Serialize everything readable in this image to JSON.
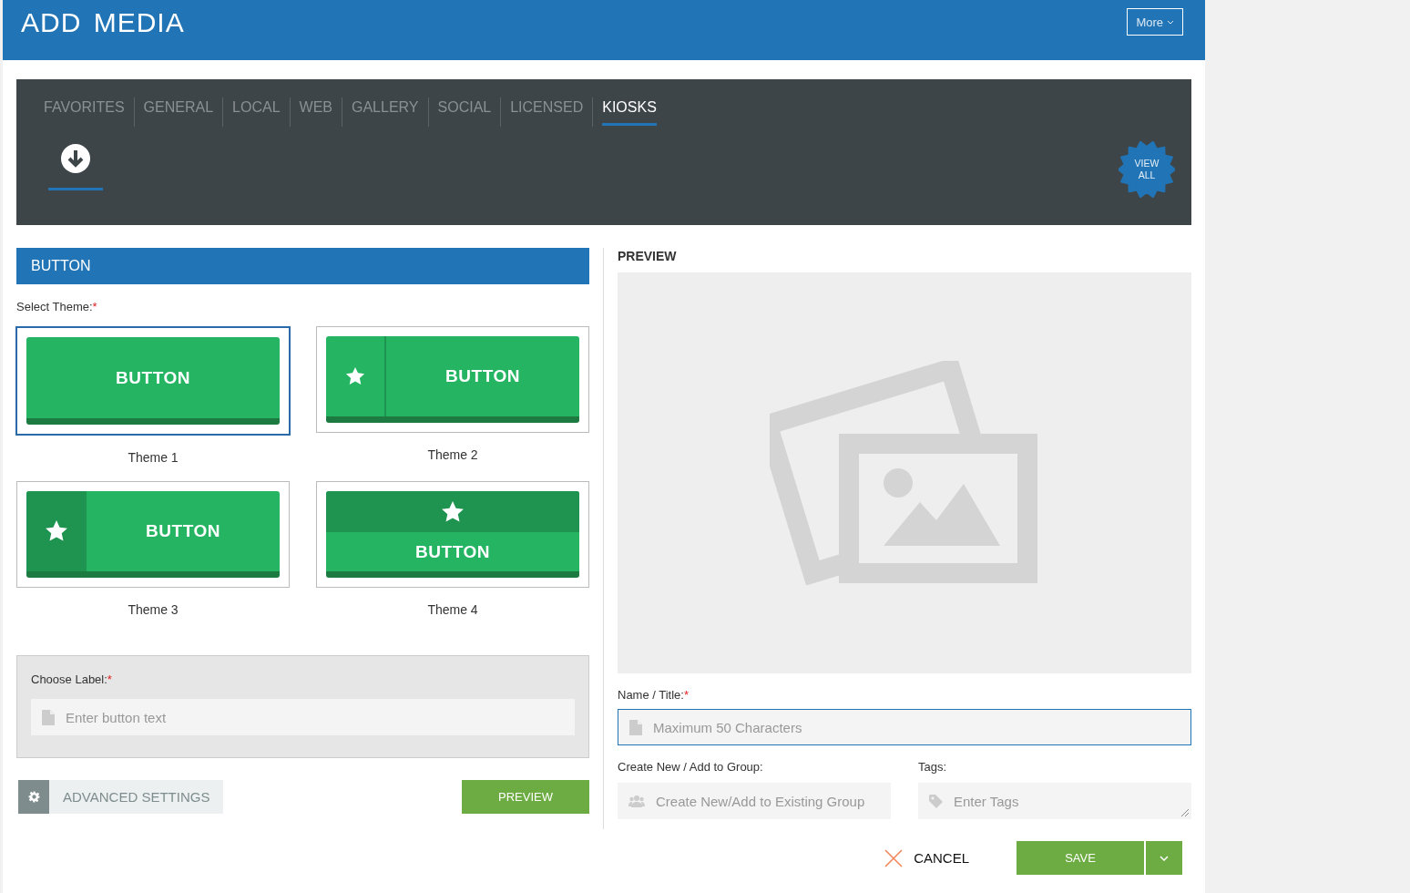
{
  "header": {
    "title": "ADD MEDIA",
    "more_button": "More"
  },
  "tabs": [
    {
      "label": "FAVORITES",
      "selected": false
    },
    {
      "label": "GENERAL",
      "selected": false
    },
    {
      "label": "LOCAL",
      "selected": false
    },
    {
      "label": "WEB",
      "selected": false
    },
    {
      "label": "GALLERY",
      "selected": false
    },
    {
      "label": "SOCIAL",
      "selected": false
    },
    {
      "label": "LICENSED",
      "selected": false
    },
    {
      "label": "KIOSKS",
      "selected": true
    }
  ],
  "subtabs": [
    {
      "kind": "download",
      "selected": true
    }
  ],
  "view_all": [
    "VIEW",
    "ALL"
  ],
  "section_title": "BUTTON",
  "theme_label": "Select Theme:",
  "required_mark": "*",
  "themes": [
    {
      "kind": "plain",
      "caption": "BUTTON",
      "label": "Theme 1",
      "selected": true
    },
    {
      "kind": "icon-left",
      "caption": "BUTTON",
      "label": "Theme 2",
      "selected": false
    },
    {
      "kind": "icon-block",
      "caption": "BUTTON",
      "label": "Theme 3",
      "selected": false
    },
    {
      "kind": "icon-top",
      "caption": "BUTTON",
      "label": "Theme 4",
      "selected": false
    }
  ],
  "choose_label": {
    "label": "Choose Label:",
    "placeholder": "Enter button text"
  },
  "advanced_settings": "ADVANCED SETTINGS",
  "preview_button": "PREVIEW",
  "preview": {
    "title": "PREVIEW"
  },
  "name_field": {
    "label": "Name / Title:",
    "placeholder": "Maximum 50 Characters"
  },
  "group_field": {
    "label": "Create New / Add to Group:",
    "placeholder": "Create New/Add to Existing Group"
  },
  "tags_field": {
    "label": "Tags:",
    "placeholder": "Enter Tags"
  },
  "cancel": "CANCEL",
  "save": "SAVE"
}
